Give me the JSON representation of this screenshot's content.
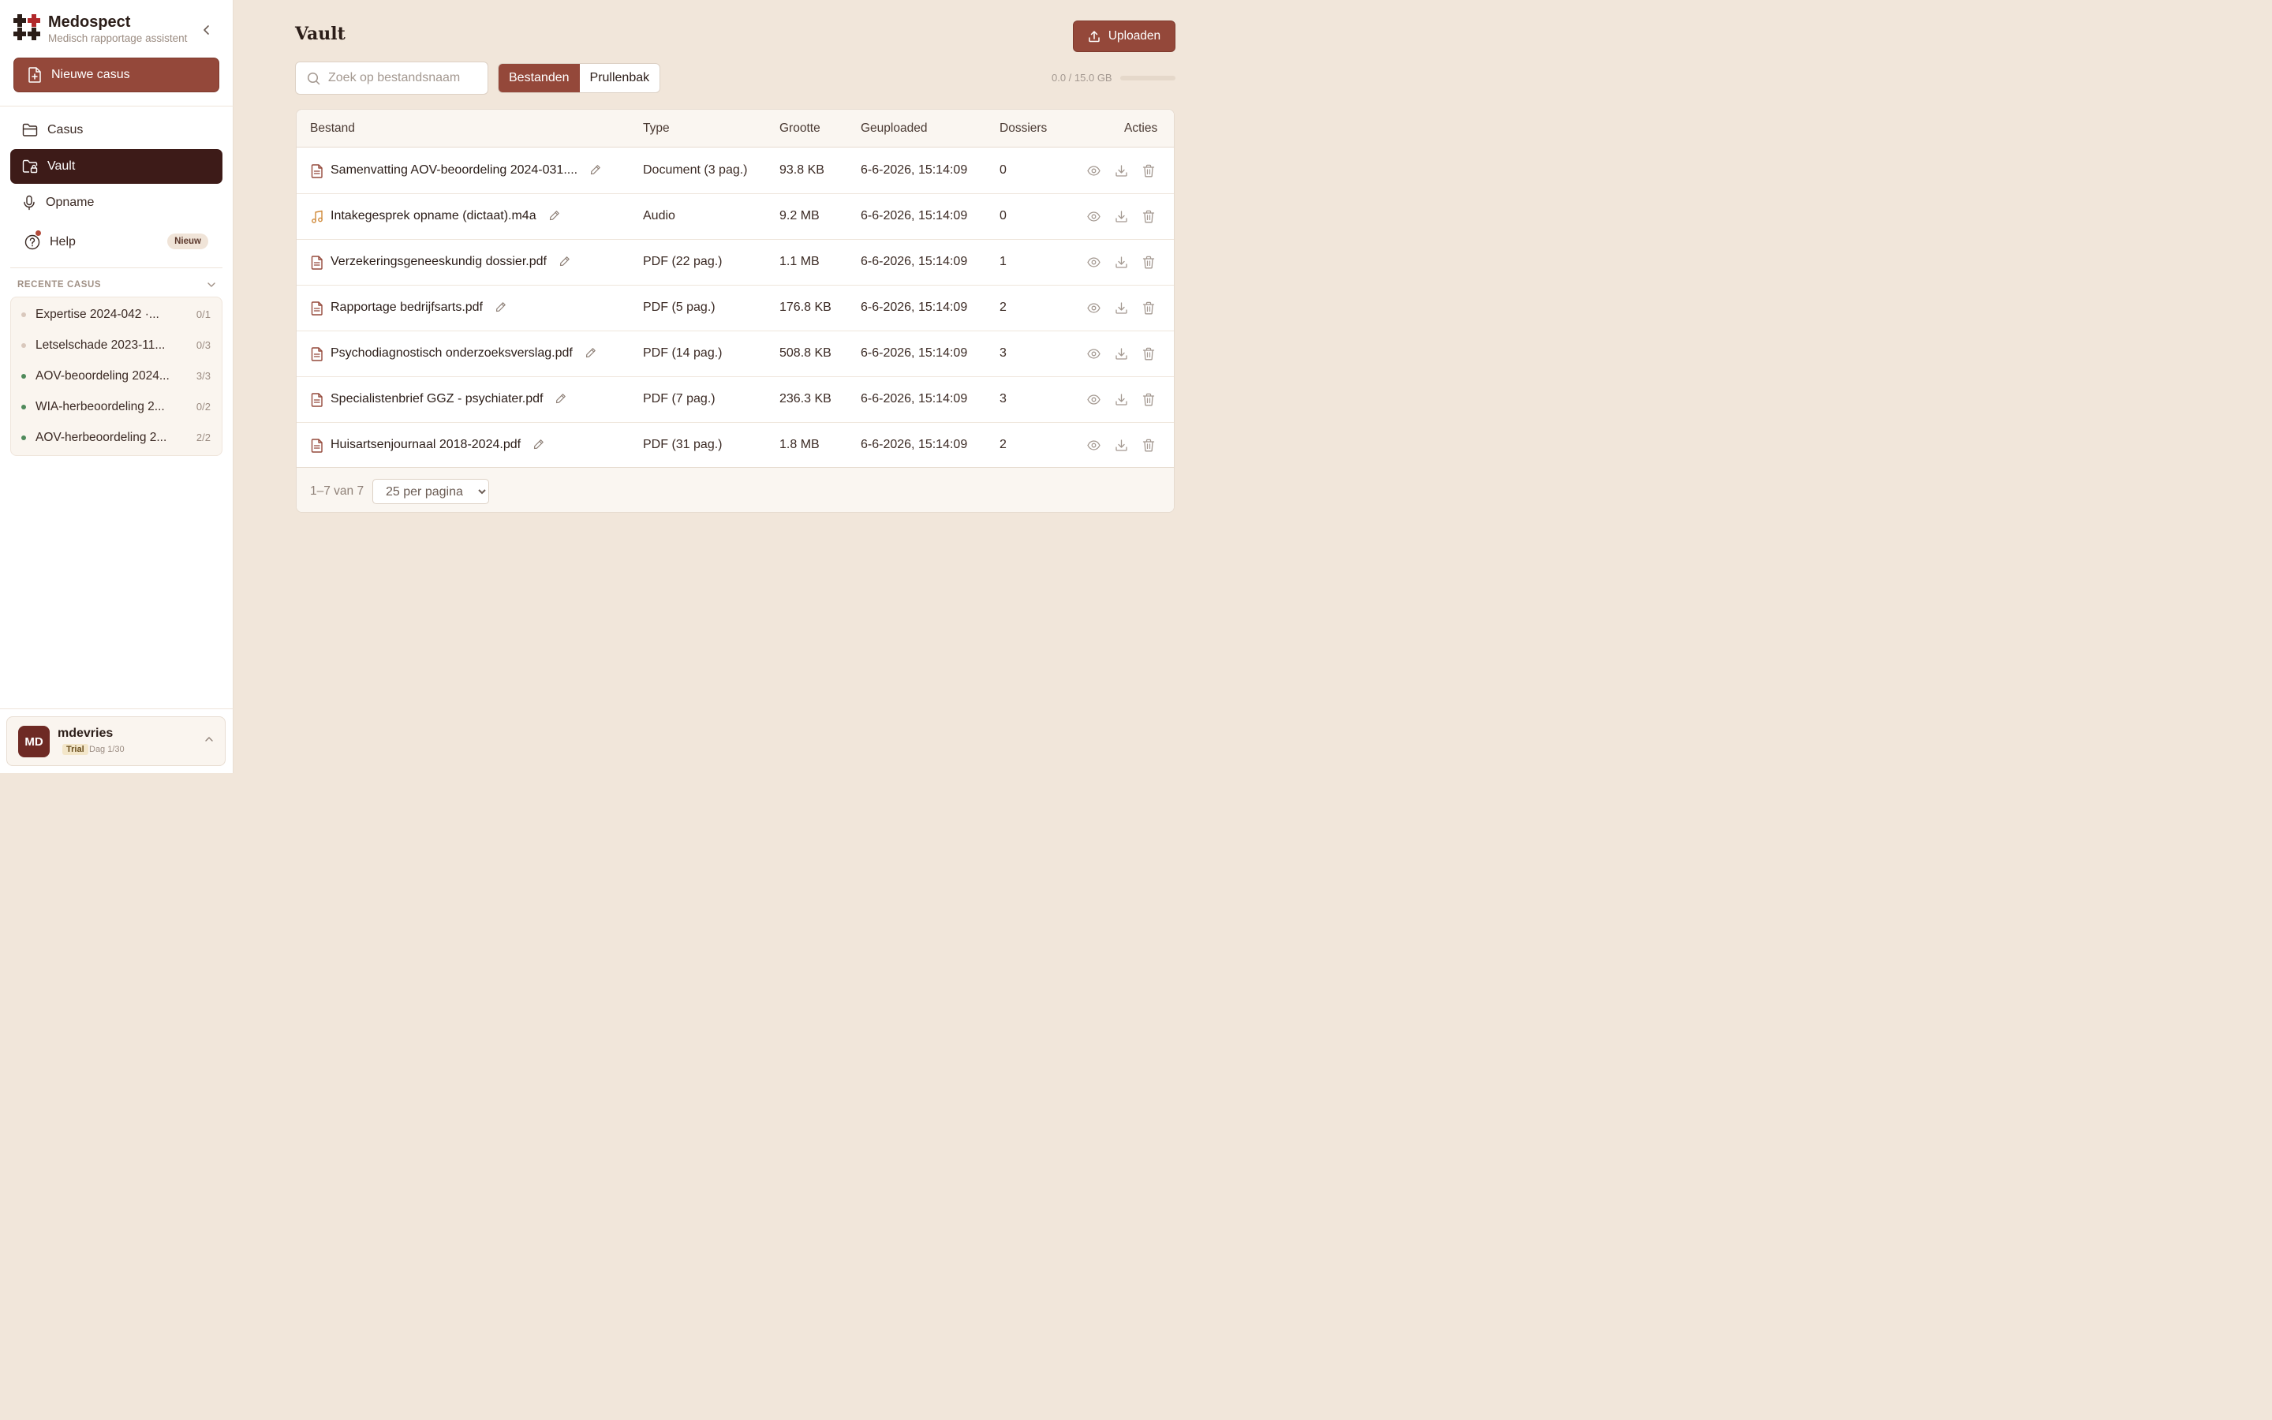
{
  "brand": {
    "name": "Medospect",
    "subtitle": "Medisch rapportage assistent"
  },
  "sidebar": {
    "new_case_label": "Nieuwe casus",
    "nav": [
      {
        "label": "Casus",
        "icon": "folder-icon",
        "active": false
      },
      {
        "label": "Vault",
        "icon": "folder-lock-icon",
        "active": true
      },
      {
        "label": "Opname",
        "icon": "microphone-icon",
        "active": false
      },
      {
        "label": "Help",
        "icon": "help-circle-icon",
        "active": false,
        "badge": "Nieuw"
      }
    ],
    "recent_header": "RECENTE CASUS",
    "recent": [
      {
        "label": "Expertise 2024-042 ·...",
        "count": "0/1",
        "dot_color": "#d9c8bc"
      },
      {
        "label": "Letselschade 2023-11...",
        "count": "0/3",
        "dot_color": "#d9c8bc"
      },
      {
        "label": "AOV-beoordeling 2024...",
        "count": "3/3",
        "dot_color": "#4f8a5b"
      },
      {
        "label": "WIA-herbeoordeling 2...",
        "count": "0/2",
        "dot_color": "#4f8a5b"
      },
      {
        "label": "AOV-herbeoordeling 2...",
        "count": "2/2",
        "dot_color": "#4f8a5b"
      }
    ],
    "user": {
      "initials": "MD",
      "name": "mdevries",
      "plan": "Trial",
      "day": "Dag 1/30"
    }
  },
  "main": {
    "title": "Vault",
    "upload_label": "Uploaden",
    "search_placeholder": "Zoek op bestandsnaam",
    "tabs": [
      {
        "label": "Bestanden",
        "active": true
      },
      {
        "label": "Prullenbak",
        "active": false
      }
    ],
    "storage_text": "0.0 / 15.0 GB",
    "storage_used_fraction": 0,
    "columns": [
      "Bestand",
      "Type",
      "Grootte",
      "Geuploaded",
      "Dossiers",
      "Acties"
    ],
    "rows": [
      {
        "name": "Samenvatting AOV-beoordeling 2024-031....",
        "type": "Document (3 pag.)",
        "size": "93.8 KB",
        "date": "6-6-2026, 15:14:09",
        "dossiers": "0",
        "icon": "file-text-icon"
      },
      {
        "name": "Intakegesprek opname (dictaat).m4a",
        "type": "Audio",
        "size": "9.2 MB",
        "date": "6-6-2026, 15:14:09",
        "dossiers": "0",
        "icon": "music-icon"
      },
      {
        "name": "Verzekeringsgeneeskundig dossier.pdf",
        "type": "PDF (22 pag.)",
        "size": "1.1 MB",
        "date": "6-6-2026, 15:14:09",
        "dossiers": "1",
        "icon": "file-text-icon"
      },
      {
        "name": "Rapportage bedrijfsarts.pdf",
        "type": "PDF (5 pag.)",
        "size": "176.8 KB",
        "date": "6-6-2026, 15:14:09",
        "dossiers": "2",
        "icon": "file-text-icon"
      },
      {
        "name": "Psychodiagnostisch onderzoeksverslag.pdf",
        "type": "PDF (14 pag.)",
        "size": "508.8 KB",
        "date": "6-6-2026, 15:14:09",
        "dossiers": "3",
        "icon": "file-text-icon"
      },
      {
        "name": "Specialistenbrief GGZ - psychiater.pdf",
        "type": "PDF (7 pag.)",
        "size": "236.3 KB",
        "date": "6-6-2026, 15:14:09",
        "dossiers": "3",
        "icon": "file-text-icon"
      },
      {
        "name": "Huisartsenjournaal 2018-2024.pdf",
        "type": "PDF (31 pag.)",
        "size": "1.8 MB",
        "date": "6-6-2026, 15:14:09",
        "dossiers": "2",
        "icon": "file-text-icon"
      }
    ],
    "pagination": {
      "range": "1–7 van 7",
      "per_page": "25 per pagina"
    }
  },
  "colors": {
    "accent": "#94483a",
    "active_nav": "#3d1b18",
    "background": "#f1e6da"
  }
}
